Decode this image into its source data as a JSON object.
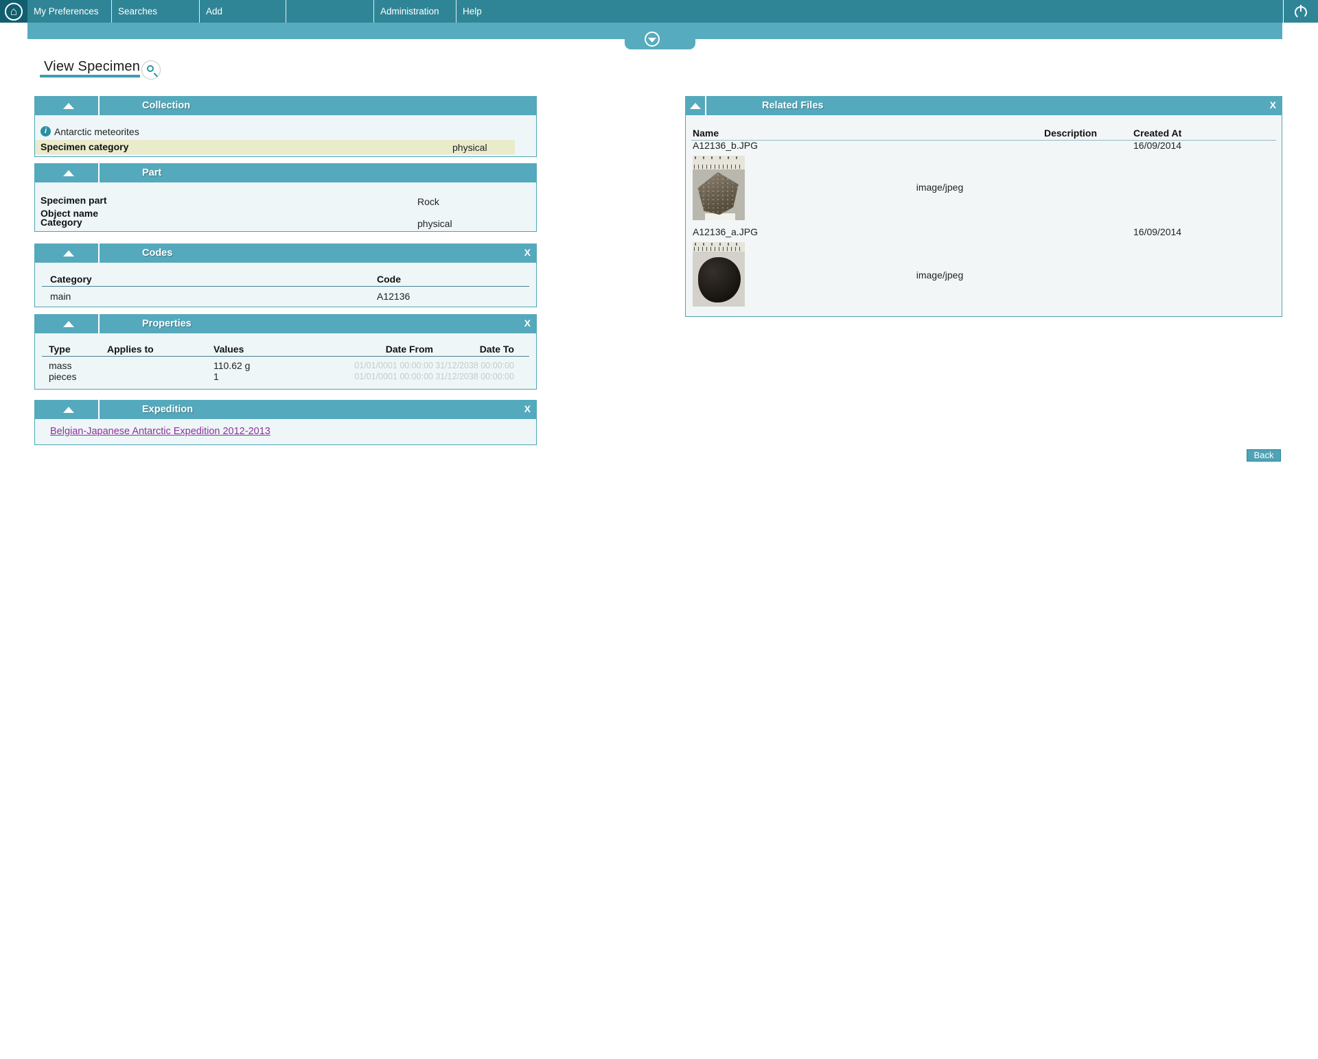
{
  "nav": {
    "items": [
      {
        "label": "My Preferences"
      },
      {
        "label": "Searches"
      },
      {
        "label": "Add"
      },
      {
        "label": ""
      },
      {
        "label": "Administration"
      },
      {
        "label": "Help"
      }
    ]
  },
  "page": {
    "title": "View Specimen"
  },
  "panels": {
    "collection": {
      "title": "Collection",
      "info_text": "Antarctic meteorites",
      "row_label": "Specimen category",
      "row_value": "physical"
    },
    "part": {
      "title": "Part",
      "rows": [
        {
          "label": "Specimen part",
          "value": "Rock"
        },
        {
          "label": "Object name",
          "value": ""
        },
        {
          "label": "Category",
          "value": "physical"
        }
      ]
    },
    "codes": {
      "title": "Codes",
      "close": "X",
      "col_category": "Category",
      "col_code": "Code",
      "row_category": "main",
      "row_code": "A12136"
    },
    "properties": {
      "title": "Properties",
      "close": "X",
      "col_type": "Type",
      "col_applies": "Applies to",
      "col_values": "Values",
      "col_date_from": "Date From",
      "col_date_to": "Date To",
      "rows": [
        {
          "type": "mass",
          "applies": "",
          "values": "110.62 g",
          "date_from": "01/01/0001 00:00:00",
          "date_to": "31/12/2038 00:00:00"
        },
        {
          "type": "pieces",
          "applies": "",
          "values": "1",
          "date_from": "01/01/0001 00:00:00",
          "date_to": "31/12/2038 00:00:00"
        }
      ]
    },
    "expedition": {
      "title": "Expedition",
      "close": "X",
      "link": "Belgian-Japanese Antarctic Expedition 2012-2013"
    },
    "related_files": {
      "title": "Related Files",
      "close": "X",
      "col_name": "Name",
      "col_description": "Description",
      "col_created": "Created At",
      "files": [
        {
          "name": "A12136_b.JPG",
          "mime": "image/jpeg",
          "created": "16/09/2014"
        },
        {
          "name": "A12136_a.JPG",
          "mime": "image/jpeg",
          "created": "16/09/2014"
        }
      ]
    }
  },
  "back_button": {
    "label": "Back"
  },
  "colors": {
    "nav": "#2f8596",
    "bar": "#57abbe",
    "panel_border": "#4da2b5",
    "panel_body": "#eef6f8",
    "highlight_row": "#e9ebcb",
    "link": "#8e3399",
    "muted_date": "#c6cbcb"
  }
}
